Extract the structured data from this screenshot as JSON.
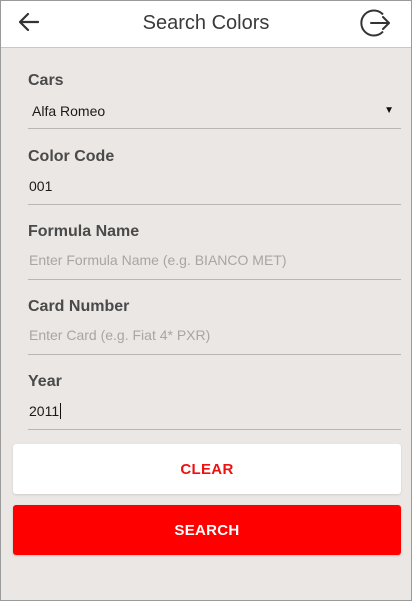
{
  "header": {
    "title": "Search Colors",
    "back_icon": "arrow-left-icon",
    "logout_icon": "logout-arrow-circle-icon"
  },
  "form": {
    "cars": {
      "label": "Cars",
      "value": "Alfa Romeo",
      "arrow": "▼"
    },
    "color_code": {
      "label": "Color Code",
      "value": "001"
    },
    "formula_name": {
      "label": "Formula Name",
      "placeholder": "Enter Formula Name (e.g. BIANCO MET)",
      "value": ""
    },
    "card_number": {
      "label": "Card Number",
      "placeholder": "Enter Card (e.g. Fiat 4* PXR)",
      "value": ""
    },
    "year": {
      "label": "Year",
      "value": "2011"
    }
  },
  "buttons": {
    "clear_label": "CLEAR",
    "search_label": "SEARCH"
  },
  "colors": {
    "accent": "#ff0000",
    "background": "#ebe7e4",
    "appbar": "#ffffff"
  }
}
